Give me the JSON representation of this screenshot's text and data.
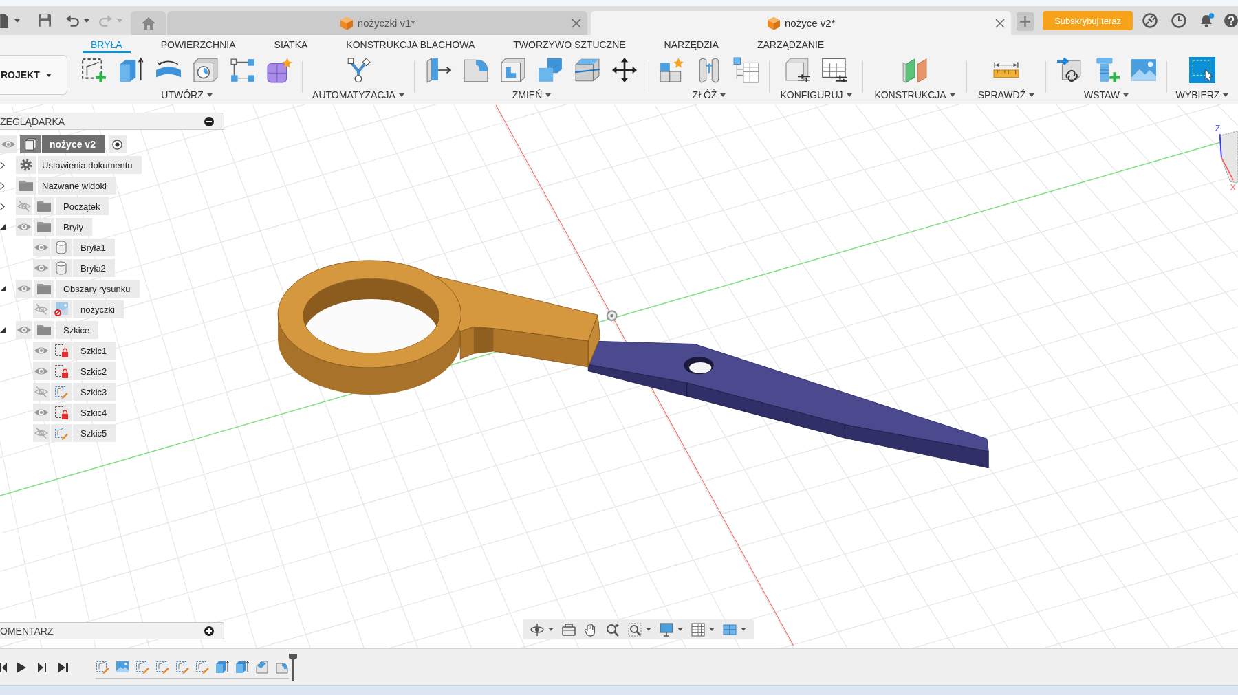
{
  "quick_access": {
    "undo_disabled": false,
    "redo_disabled": true
  },
  "document_tabs": [
    {
      "title": "nożyczki v1*",
      "selected": false
    },
    {
      "title": "nożyce v2*",
      "selected": true
    }
  ],
  "subscribe_button": "Subskrybuj teraz",
  "notifications": {
    "unread": true
  },
  "toolbar": {
    "workspace": "ROJEKT",
    "tabs": [
      {
        "label": "BRYŁA",
        "selected": true
      },
      {
        "label": "POWIERZCHNIA",
        "selected": false
      },
      {
        "label": "SIATKA",
        "selected": false
      },
      {
        "label": "KONSTRUKCJA BLACHOWA",
        "selected": false
      },
      {
        "label": "TWORZYWO SZTUCZNE",
        "selected": false
      },
      {
        "label": "NARZĘDZIA",
        "selected": false
      },
      {
        "label": "ZARZĄDZANIE",
        "selected": false
      }
    ],
    "groups": [
      {
        "label": "UTWÓRZ"
      },
      {
        "label": "AUTOMATYZACJA"
      },
      {
        "label": "ZMIEŃ"
      },
      {
        "label": "ZŁÓŻ"
      },
      {
        "label": "KONFIGURUJ"
      },
      {
        "label": "KONSTRUKCJA"
      },
      {
        "label": "SPRAWDŹ"
      },
      {
        "label": "WSTAW"
      },
      {
        "label": "WYBIERZ"
      }
    ]
  },
  "browser": {
    "title": "ZEGLĄDARKA",
    "root": {
      "name": "nożyce v2",
      "visible": true,
      "active": true
    },
    "items": [
      {
        "kind": "settings",
        "name": "Ustawienia dokumentu",
        "expanded": false
      },
      {
        "kind": "folder",
        "name": "Nazwane widoki",
        "expanded": false
      },
      {
        "kind": "folder",
        "name": "Początek",
        "visible": false,
        "expanded": false
      },
      {
        "kind": "folder",
        "name": "Bryły",
        "visible": true,
        "expanded": true,
        "children": [
          {
            "kind": "body",
            "name": "Bryła1",
            "visible": true
          },
          {
            "kind": "body",
            "name": "Bryła2",
            "visible": true
          }
        ]
      },
      {
        "kind": "folder",
        "name": "Obszary rysunku",
        "visible": true,
        "expanded": true,
        "children": [
          {
            "kind": "canvas",
            "name": "nożyczki",
            "visible": false
          }
        ]
      },
      {
        "kind": "folder",
        "name": "Szkice",
        "visible": true,
        "expanded": true,
        "children": [
          {
            "kind": "sketch",
            "name": "Szkic1",
            "visible": true,
            "locked": true
          },
          {
            "kind": "sketch",
            "name": "Szkic2",
            "visible": true,
            "locked": true
          },
          {
            "kind": "sketch",
            "name": "Szkic3",
            "visible": false,
            "locked": false
          },
          {
            "kind": "sketch",
            "name": "Szkic4",
            "visible": true,
            "locked": true
          },
          {
            "kind": "sketch",
            "name": "Szkic5",
            "visible": false,
            "locked": false
          }
        ]
      }
    ]
  },
  "comments": {
    "title": "OMENTARZ"
  },
  "view_cube": {
    "z_label": "Z",
    "x_label": "X"
  },
  "timeline": {
    "features": [
      {
        "kind": "sketch"
      },
      {
        "kind": "canvas"
      },
      {
        "kind": "sketch"
      },
      {
        "kind": "sketch"
      },
      {
        "kind": "sketch"
      },
      {
        "kind": "sketch"
      },
      {
        "kind": "extrude"
      },
      {
        "kind": "extrude"
      },
      {
        "kind": "chamfer"
      },
      {
        "kind": "fillet"
      }
    ]
  }
}
